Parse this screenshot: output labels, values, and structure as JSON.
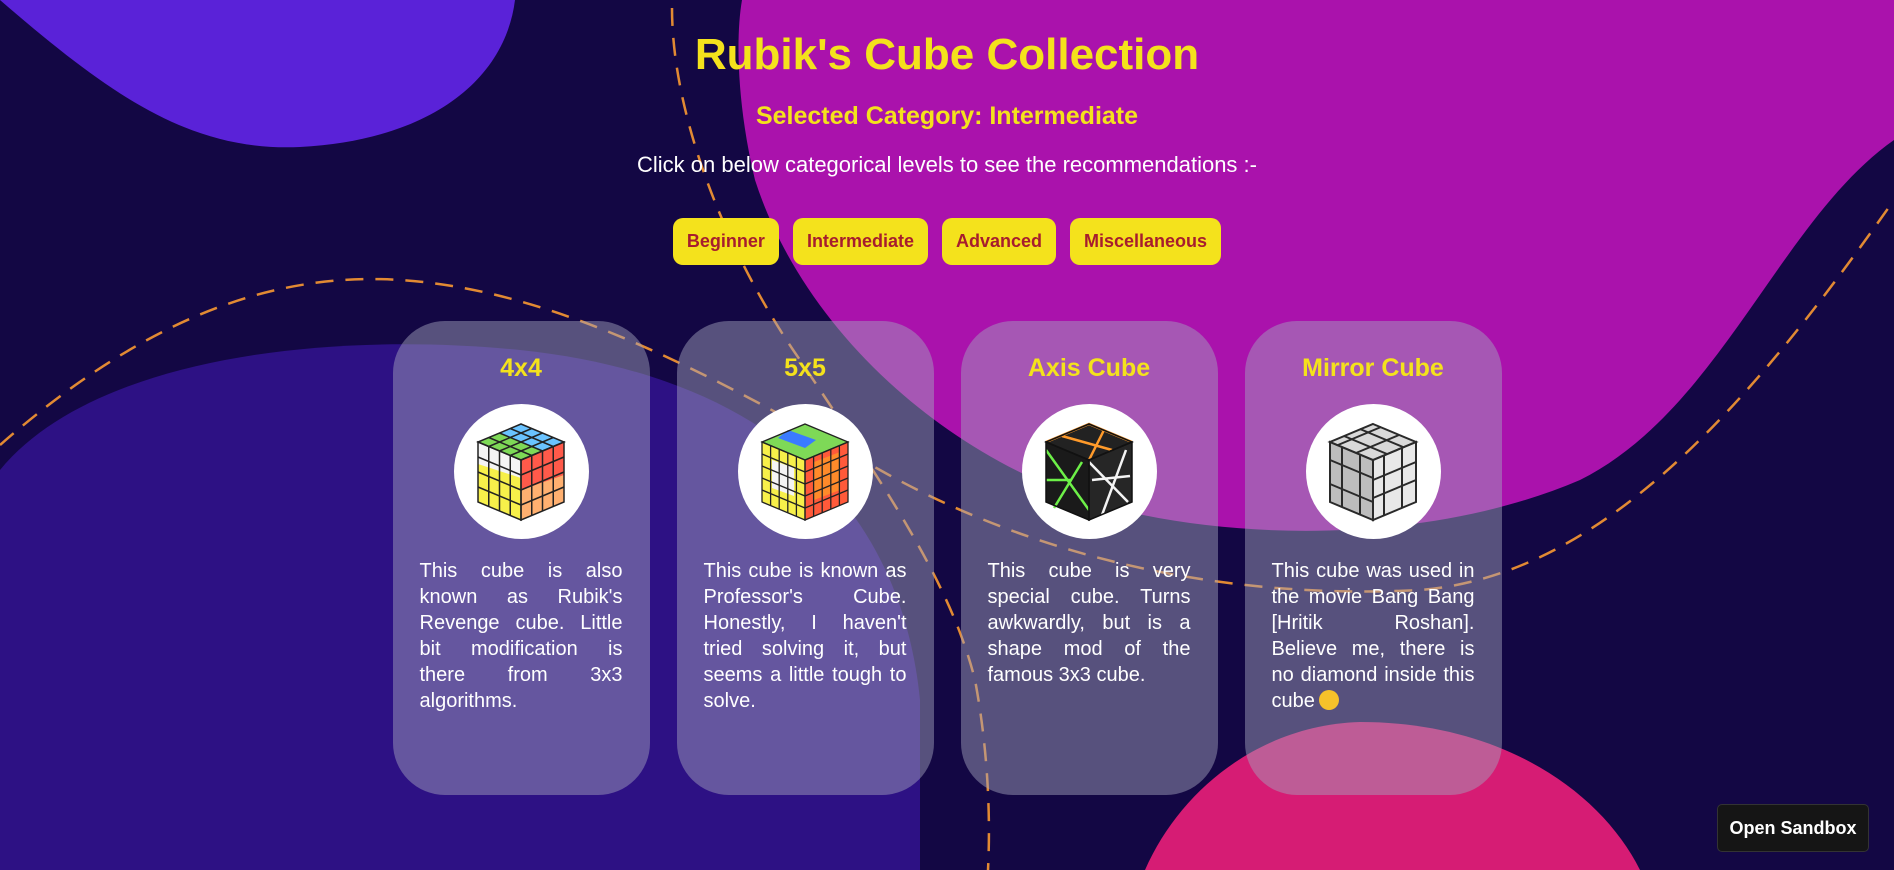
{
  "header": {
    "title": "Rubik's Cube Collection",
    "selected_category": "Selected Category: Intermediate",
    "instruction": "Click on below categorical levels to see the recommendations :-"
  },
  "categories": [
    {
      "label": "Beginner"
    },
    {
      "label": "Intermediate"
    },
    {
      "label": "Advanced"
    },
    {
      "label": "Miscellaneous"
    }
  ],
  "cards": [
    {
      "title": "4x4",
      "image": "4x4-cube-image",
      "description": "This cube is also known as Rubik's Revenge cube. Little bit modification is there from 3x3 algorithms."
    },
    {
      "title": "5x5",
      "image": "5x5-cube-image",
      "description": "This cube is known as Professor's Cube. Honestly, I haven't tried solving it, but seems a little tough to solve."
    },
    {
      "title": "Axis Cube",
      "image": "axis-cube-image",
      "description": "This cube is very special cube. Turns awkwardly, but is a shape mod of the famous 3x3 cube."
    },
    {
      "title": "Mirror Cube",
      "image": "mirror-cube-image",
      "description": "This cube was used in the movie Bang Bang [Hritik Roshan]. Believe me, there is no diamond inside this cube",
      "emoji": "laughing-face-emoji"
    }
  ],
  "sandbox": {
    "label": "Open Sandbox"
  },
  "colors": {
    "background": "#130744",
    "accent_yellow": "#f4e21c",
    "button_text": "#a61d2e",
    "card_overlay": "#a2a2bc",
    "blob_purple": "#5a22d8",
    "blob_magenta": "#aa12ac",
    "blob_pink": "#d61c74",
    "blob_indigo": "#2d1184",
    "dashed_line": "#e28a33"
  }
}
